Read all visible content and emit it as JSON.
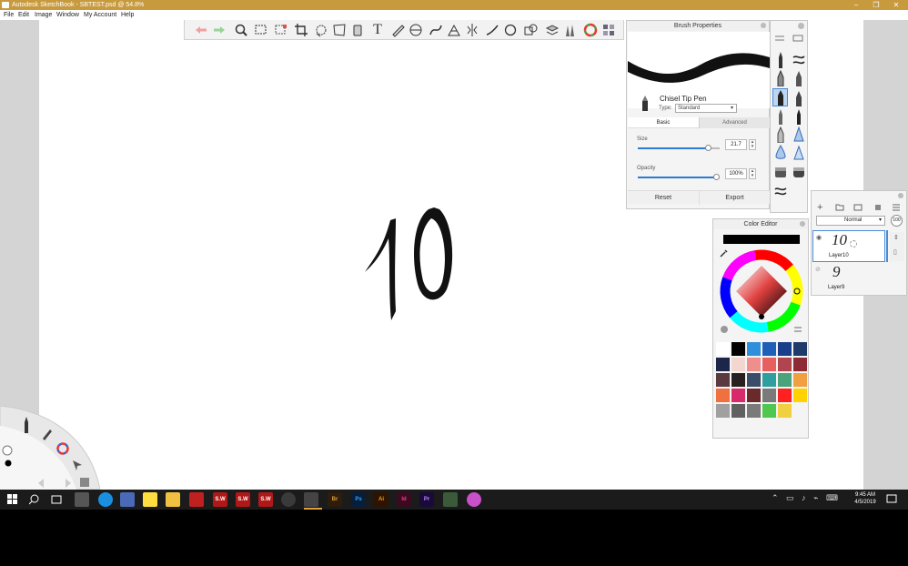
{
  "window": {
    "title": "Autodesk SketchBook - SBTEST.psd @ 54.8%",
    "minimize_glyph": "–",
    "restore_glyph": "❐",
    "close_glyph": "✕"
  },
  "menu": {
    "file": "File",
    "edit": "Edit",
    "image": "Image",
    "window": "Window",
    "account": "My Account",
    "help": "Help"
  },
  "toolbar": {
    "icons": [
      "undo-icon",
      "redo-icon",
      "zoom-icon",
      "select-icon",
      "crop-select-icon",
      "crop-icon",
      "lasso-icon",
      "distort-icon",
      "bucket-icon",
      "text-icon",
      "ruler-icon",
      "ellipse-guide-icon",
      "curve-ruler-icon",
      "perspective-icon",
      "symmetry-icon",
      "stroke-icon",
      "fill-icon",
      "copy-icon",
      "layer-icon",
      "brush-library-icon",
      "color-wheel-icon",
      "copic-icon"
    ],
    "text_tool_glyph": "T"
  },
  "brush_properties": {
    "title": "Brush Properties",
    "brush_name": "Chisel Tip Pen",
    "type_label": "Type:",
    "type_value": "Standard",
    "tab_basic": "Basic",
    "tab_advanced": "Advanced",
    "size_label": "Size",
    "size_value": "21.7",
    "opacity_label": "Opacity",
    "opacity_value": "100%",
    "reset_label": "Reset",
    "export_label": "Export"
  },
  "layers": {
    "blend_mode": "Normal",
    "opacity": "100",
    "items": [
      {
        "name": "Layer10",
        "thumb": "10"
      },
      {
        "name": "Layer9",
        "thumb": "9"
      }
    ]
  },
  "color_editor": {
    "title": "Color Editor",
    "current_color": "#000000",
    "swatches": [
      "#ffffff",
      "#000000",
      "#2f8fdc",
      "#1f5fb8",
      "#1a3f8a",
      "#203a6a",
      "#1c2648",
      "#f3d6cf",
      "#f08e8e",
      "#e66060",
      "#b0454f",
      "#8e2a33",
      "#5a3a3e",
      "#2a1f20",
      "#3a4e6a",
      "#2e9e9e",
      "#4aa37a",
      "#f0a040",
      "#f07040",
      "#d62a6a",
      "#6a2a2a",
      "#7a7a7a",
      "#ff2020",
      "#ffd200",
      "#a0a0a0",
      "#606060",
      "#7a7a7a",
      "#50c850",
      "#f0d040"
    ]
  },
  "canvas": {
    "artwork": "10"
  },
  "taskbar": {
    "time": "9:45 AM",
    "date": "4/5/2019",
    "apps": [
      "Br",
      "Ps",
      "Ai",
      "Id",
      "Pr"
    ],
    "pdf1": "S.W",
    "pdf2": "S.W",
    "pdf3": "S.W"
  },
  "colors": {
    "titlebar": "#c89a3e",
    "accent": "#2a7ad6",
    "taskbar": "#1b1b1b"
  }
}
